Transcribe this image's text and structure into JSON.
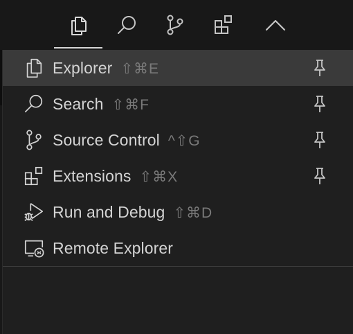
{
  "activity_bar": {
    "buttons": [
      {
        "name": "explorer",
        "icon": "files-icon",
        "active": true
      },
      {
        "name": "search",
        "icon": "search-icon"
      },
      {
        "name": "source-control",
        "icon": "source-control-icon"
      },
      {
        "name": "extensions",
        "icon": "extensions-icon"
      },
      {
        "name": "collapse",
        "icon": "chevron-up-icon"
      }
    ]
  },
  "menu": {
    "items": [
      {
        "label": "Explorer",
        "shortcut": "⇧⌘E",
        "icon": "files-icon",
        "pinned": true,
        "selected": true
      },
      {
        "label": "Search",
        "shortcut": "⇧⌘F",
        "icon": "search-icon",
        "pinned": true
      },
      {
        "label": "Source Control",
        "shortcut": "^⇧G",
        "icon": "source-control-icon",
        "pinned": true
      },
      {
        "label": "Extensions",
        "shortcut": "⇧⌘X",
        "icon": "extensions-icon",
        "pinned": true
      },
      {
        "label": "Run and Debug",
        "shortcut": "⇧⌘D",
        "icon": "run-debug-icon",
        "pinned": false
      },
      {
        "label": "Remote Explorer",
        "shortcut": "",
        "icon": "remote-explorer-icon",
        "pinned": false
      }
    ]
  },
  "colors": {
    "background": "#181818",
    "menu_background": "#1f1f1f",
    "selected_row": "#3a3a3a",
    "text": "#d4d4d4",
    "shortcut_text": "#7a7a7a"
  }
}
